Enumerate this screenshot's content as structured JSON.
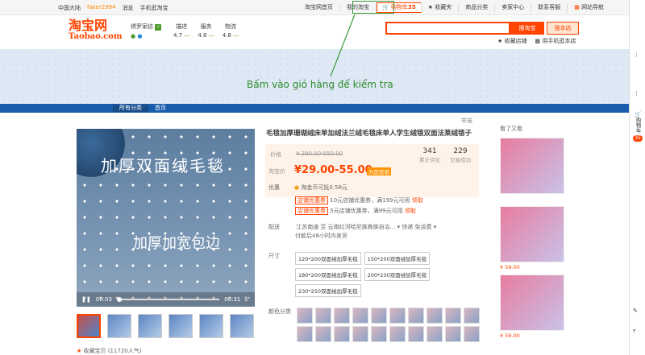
{
  "topbar": {
    "region": "中国大陆",
    "user": "faker2994",
    "messages": "消息",
    "mobile_shop": "手机逛淘宝",
    "home": "淘宝网首页",
    "my_taobao": "我的淘宝",
    "cart_label": "购物车",
    "cart_count": "35",
    "favorites": "收藏夹",
    "categories": "商品分类",
    "seller_center": "卖家中心",
    "service": "联系客服",
    "site_nav": "网站导航"
  },
  "header": {
    "logo_cn": "淘宝网",
    "logo_en": "Taobao.com",
    "shop_name": "绣罗家纺",
    "rating_labels": [
      "描述",
      "服务",
      "物流"
    ],
    "rating_values": [
      "4.7",
      "4.8",
      "4.8"
    ],
    "search_button": "搜淘宝",
    "search_shop_button": "搜本店",
    "fav_shop": "收藏店铺",
    "mobile_visit": "用手机逛本店"
  },
  "annotation": "Bấm vào giỏ hàng để kiểm tra",
  "nav": {
    "items": [
      "所有分类",
      "首页"
    ]
  },
  "report": "举报",
  "video": {
    "text1": "加厚双面绒毛毯",
    "text2": "加厚加宽包边",
    "time_current": "00:03",
    "time_total": "00:31"
  },
  "product": {
    "title": "毛毯加厚珊瑚绒床单加绒法兰绒毛毯床单人学生绒毯双面法莱绒毯子",
    "price_label": "价格",
    "original_price": "¥ 290.00-550.00",
    "taobao_price_label": "淘宝价",
    "price": "¥29.00-55.00",
    "price_tag": "为您促销",
    "promo_label": "优惠",
    "coin_text": "淘金币可抵0.58元",
    "reviews": "341",
    "reviews_label": "累计评论",
    "sales": "229",
    "sales_label": "交易成功",
    "coupon1_tag": "店铺优惠券",
    "coupon1_text": "10元店铺优惠券，满199元可用",
    "coupon1_action": "领取",
    "coupon2_tag": "店铺优惠券",
    "coupon2_text": "5元店铺优惠券，满99元可用",
    "coupon2_action": "领取",
    "delivery_label": "配送",
    "delivery_from": "江苏南通 至 云南红河哈尼族彝族自治...",
    "delivery_fee": "快递 免运费",
    "delivery_time": "付款后48小时内发货",
    "size_label": "尺寸",
    "sizes": [
      "120*200双面绒加厚毛毯",
      "150*200双面绒加厚毛毯",
      "180*200双面绒加厚毛毯",
      "200*230双面绒加厚毛毯",
      "230*250双面绒加厚毛毯"
    ],
    "color_label": "颜色分类",
    "favorite_item": "收藏宝贝 (11720人气)"
  },
  "sidebar": {
    "heading": "看了又看",
    "prices": [
      "¥ 59.00",
      "¥ 59.00"
    ]
  },
  "rightbar": {
    "cart_label": "购物车",
    "cart_count": "35"
  }
}
